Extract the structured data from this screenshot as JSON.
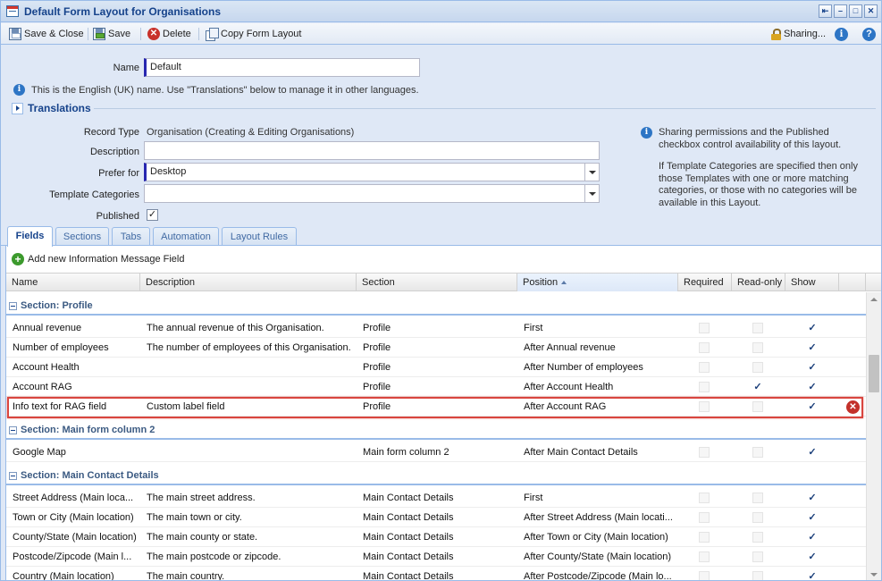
{
  "window": {
    "title": "Default Form Layout for Organisations",
    "buttons": [
      "⇤",
      "–",
      "□",
      "✕"
    ]
  },
  "toolbar": {
    "save_close": "Save & Close",
    "save": "Save",
    "delete": "Delete",
    "copy_layout": "Copy Form Layout",
    "sharing": "Sharing...",
    "info_glyph": "i",
    "help_glyph": "?"
  },
  "form": {
    "name_label": "Name",
    "name_value": "Default",
    "name_note": "This is the English (UK) name. Use \"Translations\" below to manage it in other languages.",
    "translations": "Translations",
    "record_type_label": "Record Type",
    "record_type_value": "Organisation (Creating & Editing Organisations)",
    "description_label": "Description",
    "description_value": "",
    "prefer_for_label": "Prefer for",
    "prefer_for_value": "Desktop",
    "template_categories_label": "Template Categories",
    "template_categories_value": "",
    "published_label": "Published",
    "published_checked": true,
    "side_note_1": "Sharing permissions and the Published checkbox control availability of this layout.",
    "side_note_2": "If Template Categories are specified then only those Templates with one or more matching categories, or those with no categories will be available in this Layout."
  },
  "tabs": [
    "Fields",
    "Sections",
    "Tabs",
    "Automation",
    "Layout Rules"
  ],
  "add_field": "Add new Information Message Field",
  "grid": {
    "columns": [
      "Name",
      "Description",
      "Section",
      "Position",
      "Required",
      "Read-only",
      "Show"
    ],
    "sorted_column": "Position",
    "groups": [
      {
        "title": "Section: Profile",
        "rows": [
          {
            "name": "Annual revenue",
            "description": "The annual revenue of this Organisation.",
            "section": "Profile",
            "position": "First",
            "required": false,
            "readonly": false,
            "show": true
          },
          {
            "name": "Number of employees",
            "description": "The number of employees of this Organisation.",
            "section": "Profile",
            "position": "After Annual revenue",
            "required": false,
            "readonly": false,
            "show": true
          },
          {
            "name": "Account Health",
            "description": "",
            "section": "Profile",
            "position": "After Number of employees",
            "required": false,
            "readonly": false,
            "show": true
          },
          {
            "name": "Account RAG",
            "description": "",
            "section": "Profile",
            "position": "After Account Health",
            "required": false,
            "readonly": true,
            "show": true
          },
          {
            "name": "Info text for RAG field",
            "description": "Custom label field",
            "section": "Profile",
            "position": "After Account RAG",
            "required": false,
            "readonly": false,
            "show": true,
            "highlight": true
          }
        ]
      },
      {
        "title": "Section: Main form column 2",
        "rows": [
          {
            "name": "Google Map",
            "description": "",
            "section": "Main form column 2",
            "position": "After Main Contact Details",
            "required": false,
            "readonly": false,
            "show": true
          }
        ]
      },
      {
        "title": "Section: Main Contact Details",
        "rows": [
          {
            "name": "Street Address (Main loca...",
            "description": "The main street address.",
            "section": "Main Contact Details",
            "position": "First",
            "required": false,
            "readonly": false,
            "show": true
          },
          {
            "name": "Town or City (Main location)",
            "description": "The main town or city.",
            "section": "Main Contact Details",
            "position": "After Street Address (Main locati...",
            "required": false,
            "readonly": false,
            "show": true
          },
          {
            "name": "County/State (Main location)",
            "description": "The main county or state.",
            "section": "Main Contact Details",
            "position": "After Town or City (Main location)",
            "required": false,
            "readonly": false,
            "show": true
          },
          {
            "name": "Postcode/Zipcode (Main l...",
            "description": "The main postcode or zipcode.",
            "section": "Main Contact Details",
            "position": "After County/State (Main location)",
            "required": false,
            "readonly": false,
            "show": true
          },
          {
            "name": "Country (Main location)",
            "description": "The main country.",
            "section": "Main Contact Details",
            "position": "After Postcode/Zipcode (Main lo...",
            "required": false,
            "readonly": false,
            "show": true
          }
        ]
      }
    ]
  },
  "colors": {
    "accent": "#15428b",
    "highlight": "#d9453e",
    "remove": "#c3312a"
  }
}
